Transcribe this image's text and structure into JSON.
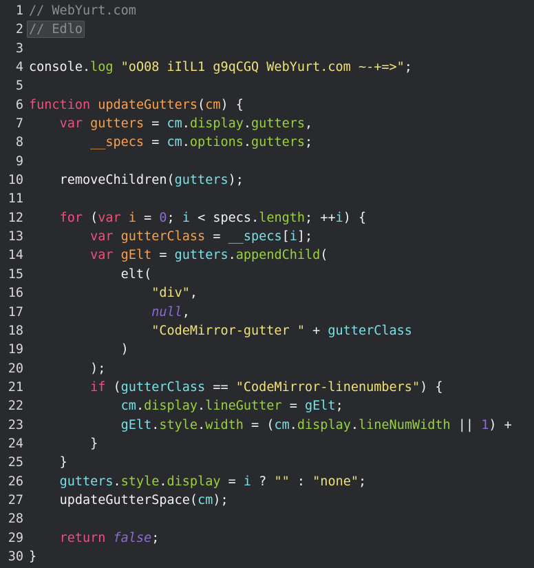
{
  "editor": {
    "background": "#282a2e",
    "gutter_color": "#d8d8d8",
    "font_size_px": 18.5,
    "line_height_px": 27.35,
    "total_lines": 30,
    "selection": {
      "line": 2,
      "text": "// Edlo",
      "background": "#3d4043",
      "border": "#55585c"
    },
    "palette": {
      "plain": "#f2f2f2",
      "comment": "#8a8f92",
      "keyword": "#f0507a",
      "def": "#f9a04b",
      "variable": "#79e0e8",
      "property": "#99d33c",
      "string": "#f0e17a",
      "number": "#8e6ad6",
      "atom": "#8e6ad6"
    }
  },
  "lines": [
    {
      "n": "1",
      "tokens": [
        {
          "t": "// WebYurt.com",
          "c": "t-comment"
        }
      ]
    },
    {
      "n": "2",
      "tokens": [
        {
          "t": "// Edlo",
          "c": "t-comment",
          "sel": true
        }
      ]
    },
    {
      "n": "3",
      "tokens": []
    },
    {
      "n": "4",
      "tokens": [
        {
          "t": "console",
          "c": "t-plain"
        },
        {
          "t": ".",
          "c": "t-plain"
        },
        {
          "t": "log",
          "c": "t-prop"
        },
        {
          "t": " ",
          "c": "t-plain"
        },
        {
          "t": "\"oO08 iIlL1 g9qCGQ WebYurt.com ~-+=>\"",
          "c": "t-string"
        },
        {
          "t": ";",
          "c": "t-plain"
        }
      ]
    },
    {
      "n": "5",
      "tokens": []
    },
    {
      "n": "6",
      "tokens": [
        {
          "t": "function",
          "c": "t-keyword"
        },
        {
          "t": " ",
          "c": "t-plain"
        },
        {
          "t": "updateGutters",
          "c": "t-def"
        },
        {
          "t": "(",
          "c": "t-bracket"
        },
        {
          "t": "cm",
          "c": "t-def"
        },
        {
          "t": ")",
          "c": "t-bracket"
        },
        {
          "t": " {",
          "c": "t-plain"
        }
      ]
    },
    {
      "n": "7",
      "tokens": [
        {
          "t": "    ",
          "c": "t-plain"
        },
        {
          "t": "var",
          "c": "t-keyword"
        },
        {
          "t": " ",
          "c": "t-plain"
        },
        {
          "t": "gutters",
          "c": "t-def"
        },
        {
          "t": " = ",
          "c": "t-op"
        },
        {
          "t": "cm",
          "c": "t-var"
        },
        {
          "t": ".",
          "c": "t-plain"
        },
        {
          "t": "display",
          "c": "t-prop"
        },
        {
          "t": ".",
          "c": "t-plain"
        },
        {
          "t": "gutters",
          "c": "t-prop"
        },
        {
          "t": ",",
          "c": "t-plain"
        }
      ]
    },
    {
      "n": "8",
      "tokens": [
        {
          "t": "        ",
          "c": "t-plain"
        },
        {
          "t": "__specs",
          "c": "t-def"
        },
        {
          "t": " = ",
          "c": "t-op"
        },
        {
          "t": "cm",
          "c": "t-var"
        },
        {
          "t": ".",
          "c": "t-plain"
        },
        {
          "t": "options",
          "c": "t-prop"
        },
        {
          "t": ".",
          "c": "t-plain"
        },
        {
          "t": "gutters",
          "c": "t-prop"
        },
        {
          "t": ";",
          "c": "t-plain"
        }
      ]
    },
    {
      "n": "9",
      "tokens": []
    },
    {
      "n": "10",
      "tokens": [
        {
          "t": "    ",
          "c": "t-plain"
        },
        {
          "t": "removeChildren",
          "c": "t-plain"
        },
        {
          "t": "(",
          "c": "t-bracket"
        },
        {
          "t": "gutters",
          "c": "t-var"
        },
        {
          "t": ")",
          "c": "t-bracket"
        },
        {
          "t": ";",
          "c": "t-plain"
        }
      ]
    },
    {
      "n": "11",
      "tokens": []
    },
    {
      "n": "12",
      "tokens": [
        {
          "t": "    ",
          "c": "t-plain"
        },
        {
          "t": "for",
          "c": "t-keyword"
        },
        {
          "t": " ",
          "c": "t-plain"
        },
        {
          "t": "(",
          "c": "t-bracket"
        },
        {
          "t": "var",
          "c": "t-keyword"
        },
        {
          "t": " ",
          "c": "t-plain"
        },
        {
          "t": "i",
          "c": "t-def"
        },
        {
          "t": " = ",
          "c": "t-op"
        },
        {
          "t": "0",
          "c": "t-number"
        },
        {
          "t": "; ",
          "c": "t-plain"
        },
        {
          "t": "i",
          "c": "t-var"
        },
        {
          "t": " < ",
          "c": "t-op"
        },
        {
          "t": "specs",
          "c": "t-plain"
        },
        {
          "t": ".",
          "c": "t-plain"
        },
        {
          "t": "length",
          "c": "t-prop"
        },
        {
          "t": "; ",
          "c": "t-plain"
        },
        {
          "t": "++",
          "c": "t-op"
        },
        {
          "t": "i",
          "c": "t-var"
        },
        {
          "t": ")",
          "c": "t-bracket"
        },
        {
          "t": " {",
          "c": "t-plain"
        }
      ]
    },
    {
      "n": "13",
      "tokens": [
        {
          "t": "        ",
          "c": "t-plain"
        },
        {
          "t": "var",
          "c": "t-keyword"
        },
        {
          "t": " ",
          "c": "t-plain"
        },
        {
          "t": "gutterClass",
          "c": "t-def"
        },
        {
          "t": " = ",
          "c": "t-op"
        },
        {
          "t": "__specs",
          "c": "t-var"
        },
        {
          "t": "[",
          "c": "t-bracket"
        },
        {
          "t": "i",
          "c": "t-var"
        },
        {
          "t": "]",
          "c": "t-bracket"
        },
        {
          "t": ";",
          "c": "t-plain"
        }
      ]
    },
    {
      "n": "14",
      "tokens": [
        {
          "t": "        ",
          "c": "t-plain"
        },
        {
          "t": "var",
          "c": "t-keyword"
        },
        {
          "t": " ",
          "c": "t-plain"
        },
        {
          "t": "gElt",
          "c": "t-def"
        },
        {
          "t": " = ",
          "c": "t-op"
        },
        {
          "t": "gutters",
          "c": "t-var"
        },
        {
          "t": ".",
          "c": "t-plain"
        },
        {
          "t": "appendChild",
          "c": "t-prop"
        },
        {
          "t": "(",
          "c": "t-bracket"
        }
      ]
    },
    {
      "n": "15",
      "tokens": [
        {
          "t": "            ",
          "c": "t-plain"
        },
        {
          "t": "elt",
          "c": "t-plain"
        },
        {
          "t": "(",
          "c": "t-bracket"
        }
      ]
    },
    {
      "n": "16",
      "tokens": [
        {
          "t": "                ",
          "c": "t-plain"
        },
        {
          "t": "\"div\"",
          "c": "t-string"
        },
        {
          "t": ",",
          "c": "t-plain"
        }
      ]
    },
    {
      "n": "17",
      "tokens": [
        {
          "t": "                ",
          "c": "t-plain"
        },
        {
          "t": "null",
          "c": "t-atom"
        },
        {
          "t": ",",
          "c": "t-plain"
        }
      ]
    },
    {
      "n": "18",
      "tokens": [
        {
          "t": "                ",
          "c": "t-plain"
        },
        {
          "t": "\"CodeMirror-gutter \"",
          "c": "t-string"
        },
        {
          "t": " + ",
          "c": "t-op"
        },
        {
          "t": "gutterClass",
          "c": "t-var"
        }
      ]
    },
    {
      "n": "19",
      "tokens": [
        {
          "t": "            ",
          "c": "t-plain"
        },
        {
          "t": ")",
          "c": "t-bracket"
        }
      ]
    },
    {
      "n": "20",
      "tokens": [
        {
          "t": "        ",
          "c": "t-plain"
        },
        {
          "t": ")",
          "c": "t-bracket"
        },
        {
          "t": ";",
          "c": "t-plain"
        }
      ]
    },
    {
      "n": "21",
      "tokens": [
        {
          "t": "        ",
          "c": "t-plain"
        },
        {
          "t": "if",
          "c": "t-keyword"
        },
        {
          "t": " ",
          "c": "t-plain"
        },
        {
          "t": "(",
          "c": "t-bracket"
        },
        {
          "t": "gutterClass",
          "c": "t-var"
        },
        {
          "t": " == ",
          "c": "t-op"
        },
        {
          "t": "\"CodeMirror-linenumbers\"",
          "c": "t-string"
        },
        {
          "t": ")",
          "c": "t-bracket"
        },
        {
          "t": " {",
          "c": "t-plain"
        }
      ]
    },
    {
      "n": "22",
      "tokens": [
        {
          "t": "            ",
          "c": "t-plain"
        },
        {
          "t": "cm",
          "c": "t-var"
        },
        {
          "t": ".",
          "c": "t-plain"
        },
        {
          "t": "display",
          "c": "t-prop"
        },
        {
          "t": ".",
          "c": "t-plain"
        },
        {
          "t": "lineGutter",
          "c": "t-prop"
        },
        {
          "t": " = ",
          "c": "t-op"
        },
        {
          "t": "gElt",
          "c": "t-var"
        },
        {
          "t": ";",
          "c": "t-plain"
        }
      ]
    },
    {
      "n": "23",
      "tokens": [
        {
          "t": "            ",
          "c": "t-plain"
        },
        {
          "t": "gElt",
          "c": "t-var"
        },
        {
          "t": ".",
          "c": "t-plain"
        },
        {
          "t": "style",
          "c": "t-prop"
        },
        {
          "t": ".",
          "c": "t-plain"
        },
        {
          "t": "width",
          "c": "t-prop"
        },
        {
          "t": " = ",
          "c": "t-op"
        },
        {
          "t": "(",
          "c": "t-bracket"
        },
        {
          "t": "cm",
          "c": "t-var"
        },
        {
          "t": ".",
          "c": "t-plain"
        },
        {
          "t": "display",
          "c": "t-prop"
        },
        {
          "t": ".",
          "c": "t-plain"
        },
        {
          "t": "lineNumWidth",
          "c": "t-prop"
        },
        {
          "t": " || ",
          "c": "t-op"
        },
        {
          "t": "1",
          "c": "t-number"
        },
        {
          "t": ")",
          "c": "t-bracket"
        },
        {
          "t": " +",
          "c": "t-op"
        }
      ]
    },
    {
      "n": "24",
      "tokens": [
        {
          "t": "        ",
          "c": "t-plain"
        },
        {
          "t": "}",
          "c": "t-plain"
        }
      ]
    },
    {
      "n": "25",
      "tokens": [
        {
          "t": "    ",
          "c": "t-plain"
        },
        {
          "t": "}",
          "c": "t-plain"
        }
      ]
    },
    {
      "n": "26",
      "tokens": [
        {
          "t": "    ",
          "c": "t-plain"
        },
        {
          "t": "gutters",
          "c": "t-var"
        },
        {
          "t": ".",
          "c": "t-plain"
        },
        {
          "t": "style",
          "c": "t-prop"
        },
        {
          "t": ".",
          "c": "t-plain"
        },
        {
          "t": "display",
          "c": "t-prop"
        },
        {
          "t": " = ",
          "c": "t-op"
        },
        {
          "t": "i",
          "c": "t-var"
        },
        {
          "t": " ? ",
          "c": "t-op"
        },
        {
          "t": "\"\"",
          "c": "t-string"
        },
        {
          "t": " : ",
          "c": "t-op"
        },
        {
          "t": "\"none\"",
          "c": "t-string"
        },
        {
          "t": ";",
          "c": "t-plain"
        }
      ]
    },
    {
      "n": "27",
      "tokens": [
        {
          "t": "    ",
          "c": "t-plain"
        },
        {
          "t": "updateGutterSpace",
          "c": "t-plain"
        },
        {
          "t": "(",
          "c": "t-bracket"
        },
        {
          "t": "cm",
          "c": "t-var"
        },
        {
          "t": ")",
          "c": "t-bracket"
        },
        {
          "t": ";",
          "c": "t-plain"
        }
      ]
    },
    {
      "n": "28",
      "tokens": []
    },
    {
      "n": "29",
      "tokens": [
        {
          "t": "    ",
          "c": "t-plain"
        },
        {
          "t": "return",
          "c": "t-keyword"
        },
        {
          "t": " ",
          "c": "t-plain"
        },
        {
          "t": "false",
          "c": "t-atom"
        },
        {
          "t": ";",
          "c": "t-plain"
        }
      ]
    },
    {
      "n": "30",
      "tokens": [
        {
          "t": "}",
          "c": "t-plain"
        }
      ]
    }
  ]
}
